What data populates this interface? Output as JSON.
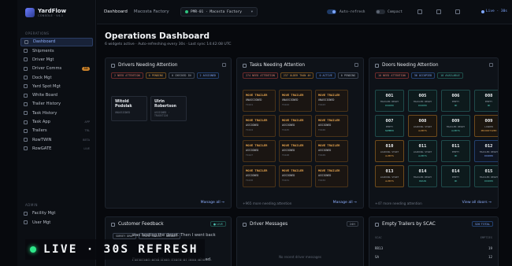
{
  "brand": {
    "name": "YardFlow",
    "subtitle": "CONSOLE · V4.1"
  },
  "sidebar": {
    "section_ops": "OPERATIONS",
    "section_admin": "ADMIN",
    "items": [
      {
        "label": "Dashboard",
        "badge": "",
        "active": true
      },
      {
        "label": "Shipments",
        "badge": ""
      },
      {
        "label": "Driver Mgt",
        "badge": ""
      },
      {
        "label": "Driver Comms",
        "badge": "12"
      },
      {
        "label": "Dock Mgt",
        "badge": ""
      },
      {
        "label": "Yard Spot Mgt",
        "badge": ""
      },
      {
        "label": "White Board",
        "badge": ""
      },
      {
        "label": "Trailer History",
        "badge": ""
      },
      {
        "label": "Task History",
        "badge": ""
      },
      {
        "label": "Task App",
        "badge": "APP"
      },
      {
        "label": "Trailers",
        "badge": "TRL"
      },
      {
        "label": "RowTWIN",
        "badge": "BETA"
      },
      {
        "label": "RowGATE",
        "badge": "LIVE"
      }
    ],
    "admin_items": [
      {
        "label": "Facility Mgt"
      },
      {
        "label": "User Mgt"
      }
    ]
  },
  "topbar": {
    "crumb_root": "Dashboard",
    "crumb_facility": "Macosta Factory",
    "facility_select": "PMR-01 · Macosta Factory",
    "auto_refresh_label": "Auto-refresh",
    "compact_label": "Compact",
    "live_label": "Live · 30s"
  },
  "main": {
    "title": "Operations Dashboard",
    "subtitle": "6 widgets active · Auto-refreshing every 30s · Last sync 14:42:08 UTC"
  },
  "drivers_widget": {
    "title": "Drivers Needing Attention",
    "pills": [
      {
        "text": "2 NEED ATTENTION",
        "tone": "red"
      },
      {
        "text": "0 PENDING",
        "tone": "orange"
      },
      {
        "text": "0 CHECKED IN",
        "tone": "gray"
      },
      {
        "text": "2 ASSIGNED",
        "tone": "blue"
      }
    ],
    "cards": [
      {
        "name": "Witold Podolak",
        "sub": "UNASSIGNED"
      },
      {
        "name": "Ulrin Robertson",
        "sub": "ASSIGNED · TRUCKT120"
      }
    ],
    "footer_link": "Manage all →"
  },
  "tasks_widget": {
    "title": "Tasks Needing Attention",
    "pills": [
      {
        "text": "274 NEED ATTENTION",
        "tone": "red"
      },
      {
        "text": "237 OLDER THAN 4H",
        "tone": "orange"
      },
      {
        "text": "0 ACTIVE",
        "tone": "blue"
      },
      {
        "text": "0 PENDING",
        "tone": "gray"
      }
    ],
    "tasks": [
      {
        "title": "MOVE TRAILER",
        "status": "UNASSIGNED",
        "id": "T4121"
      },
      {
        "title": "MOVE TRAILER",
        "status": "UNASSIGNED",
        "id": "T4122"
      },
      {
        "title": "MOVE TRAILER",
        "status": "UNASSIGNED",
        "id": "T4123"
      },
      {
        "title": "MOVE TRAILER",
        "status": "ASSIGNED",
        "id": "T4124"
      },
      {
        "title": "MOVE TRAILER",
        "status": "ASSIGNED",
        "id": "T4125"
      },
      {
        "title": "MOVE TRAILER",
        "status": "ASSIGNED",
        "id": "T4126"
      },
      {
        "title": "MOVE TRAILER",
        "status": "ASSIGNED",
        "id": "T4127"
      },
      {
        "title": "MOVE TRAILER",
        "status": "ASSIGNED",
        "id": "T4128"
      },
      {
        "title": "MOVE TRAILER",
        "status": "ASSIGNED",
        "id": "T4129"
      },
      {
        "title": "MOVE TRAILER",
        "status": "ASSIGNED",
        "id": "T4130"
      },
      {
        "title": "MOVE TRAILER",
        "status": "ASSIGNED",
        "id": "T4131"
      },
      {
        "title": "MOVE TRAILER",
        "status": "ASSIGNED",
        "id": "T4132"
      }
    ],
    "footer_note": "+965 more needing attention",
    "footer_link": "Manage all →"
  },
  "doors_widget": {
    "title": "Doors Needing Attention",
    "pills": [
      {
        "text": "10 NEED ATTENTION",
        "tone": "red"
      },
      {
        "text": "36 OCCUPIED",
        "tone": "blue"
      },
      {
        "text": "18 AVAILABLE",
        "tone": "teal"
      }
    ],
    "doors": [
      {
        "num": "001",
        "label": "TRAILER READY",
        "sub": "DOCKED",
        "tone": "teal"
      },
      {
        "num": "005",
        "label": "TRAILER READY",
        "sub": "DOCKED",
        "tone": "teal"
      },
      {
        "num": "006",
        "label": "EMPTY",
        "sub": "OK",
        "tone": "teal"
      },
      {
        "num": "008",
        "label": "EMPTY",
        "sub": "OK",
        "tone": "teal"
      },
      {
        "num": "007",
        "label": "EMPTY",
        "sub": "NUMBER",
        "tone": "teal"
      },
      {
        "num": "008",
        "label": "LOADING START",
        "sub": "ALERTS",
        "tone": "orange"
      },
      {
        "num": "009",
        "label": "TRAILER READY",
        "sub": "ALERTS",
        "tone": "teal"
      },
      {
        "num": "009",
        "label": "LOADER",
        "sub": "PRIORITIZED",
        "tone": "orange"
      },
      {
        "num": "010",
        "label": "LOADING START",
        "sub": "ALERTS",
        "tone": "orange"
      },
      {
        "num": "011",
        "label": "LOADING START",
        "sub": "ALERTS",
        "tone": "teal"
      },
      {
        "num": "011",
        "label": "EMPTY",
        "sub": "OK",
        "tone": "teal"
      },
      {
        "num": "012",
        "label": "TRAILER READY",
        "sub": "DOCKED",
        "tone": "blue"
      },
      {
        "num": "013",
        "label": "LOADING START",
        "sub": "ALERTS",
        "tone": "orange"
      },
      {
        "num": "014",
        "label": "TRAILER READY",
        "sub": "DRAIN",
        "tone": "teal"
      },
      {
        "num": "014",
        "label": "EMPTY",
        "sub": "OK",
        "tone": "teal"
      },
      {
        "num": "015",
        "label": "TRAILER READY",
        "sub": "DOCKED",
        "tone": "teal"
      }
    ],
    "footer_note": "+47 more needing attention",
    "footer_link": "View all doors →"
  },
  "feedback_widget": {
    "title": "Customer Feedback",
    "tag": "● LIVE",
    "pills": [
      {
        "text": "SURVEY DROP",
        "tone": "gray"
      },
      {
        "text": "PRIME MOVERS · WALMART",
        "tone": "gray"
      }
    ],
    "line1": "was hosting the depot. Then I went back",
    "line2": "Foreman and then more or less ahead."
  },
  "messages_widget": {
    "title": "Driver Messages",
    "tag": "24H",
    "empty": "No recent driver messages"
  },
  "trailers_widget": {
    "title": "Empty Trailers by SCAC",
    "tag": "326 TOTAL",
    "col1": "SCAC",
    "col2": "EMPTIES",
    "rows": [
      {
        "scac": "RR13",
        "count": "19"
      },
      {
        "scac": "SA",
        "count": "12"
      }
    ]
  },
  "overlay": {
    "text": "LIVE · 30S REFRESH"
  }
}
